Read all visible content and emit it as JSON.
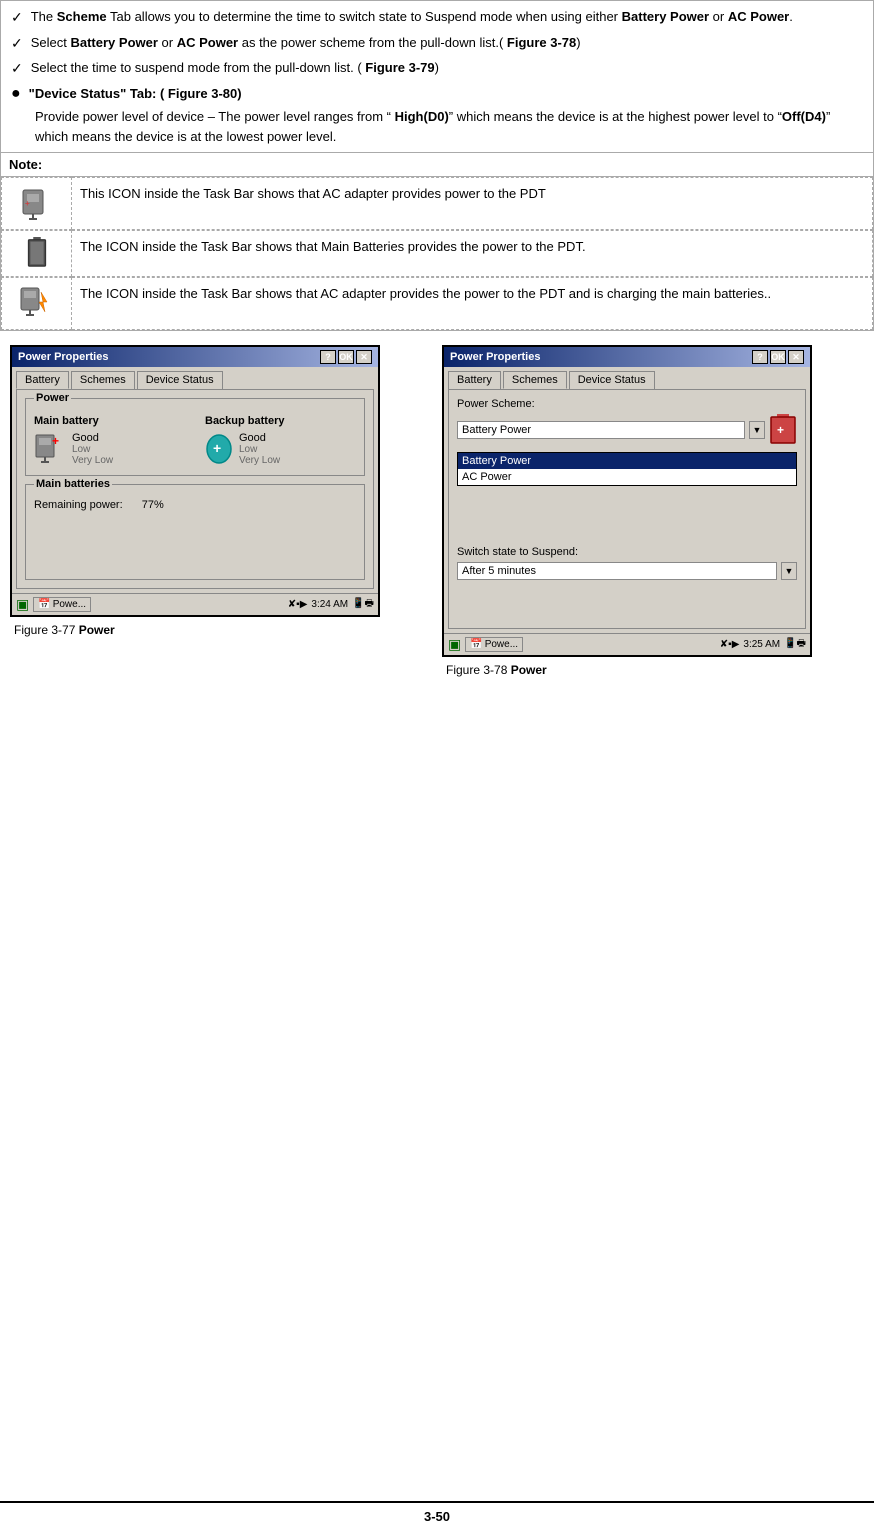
{
  "content": {
    "checklist": [
      {
        "id": "scheme-tab",
        "text_before": "The ",
        "bold1": "Scheme",
        "text_middle1": " Tab allows you to determine the time to switch state to Suspend mode when using either ",
        "bold2": "Battery Power",
        "text_middle2": " or ",
        "bold3": "AC Power",
        "text_end": "."
      },
      {
        "id": "select-power",
        "text_before": "Select ",
        "bold1": "Battery Power",
        "text_middle": " or ",
        "bold2": "AC Power",
        "text_end": " as the power scheme from the pull-down list.( ",
        "bold3": "Figure 3-78",
        "text_end2": ")"
      },
      {
        "id": "select-time",
        "text_before": "Select the time to suspend mode from the pull-down list. ( ",
        "bold1": "Figure 3-79",
        "text_end": ")"
      }
    ],
    "device_status_bullet": {
      "label": "\"Device Status\" Tab: ( Figure 3-80)",
      "description_before": "Provide power level of device – The power level ranges from “ ",
      "bold1": "High(D0)",
      "text_mid": "” which means the device is at the highest power level to “",
      "bold2": "Off(D4)",
      "text_end": "” which means the device is at the lowest power level."
    },
    "note_label": "Note:",
    "icons_table": [
      {
        "id": "ac-icon",
        "description": "This ICON inside the Task Bar shows that AC adapter provides power to the PDT"
      },
      {
        "id": "battery-icon",
        "description": "The ICON inside the Task Bar shows that Main Batteries provides the power to the PDT."
      },
      {
        "id": "charging-icon",
        "description": "The ICON inside the Task Bar shows that AC adapter provides the power to the PDT and is charging the main batteries.."
      }
    ],
    "figures": [
      {
        "id": "fig-77",
        "caption_prefix": "Figure 3-77 ",
        "caption_bold": "Power",
        "dialog": {
          "title": "Power Properties",
          "tabs": [
            "Battery",
            "Schemes",
            "Device Status"
          ],
          "active_tab": "Battery",
          "group_power": {
            "label": "Power",
            "main_battery_label": "Main battery",
            "main_battery_status": "Good",
            "main_battery_low": "Low",
            "main_battery_vlow": "Very Low",
            "backup_battery_label": "Backup battery",
            "backup_battery_status": "Good",
            "backup_battery_low": "Low",
            "backup_battery_vlow": "Very Low"
          },
          "group_main_batteries": {
            "label": "Main batteries",
            "remaining_label": "Remaining power:",
            "remaining_value": "77%"
          },
          "taskbar": {
            "start_icon": "♥",
            "powe_label": "Powe...",
            "time": "3:24 AM"
          }
        }
      },
      {
        "id": "fig-78",
        "caption_prefix": "Figure 3-78 ",
        "caption_bold": "Power",
        "dialog": {
          "title": "Power Properties",
          "tabs": [
            "Battery",
            "Schemes",
            "Device Status"
          ],
          "active_tab": "Schemes",
          "power_scheme_label": "Power Scheme:",
          "dropdown_value": "Battery Power",
          "list_items": [
            "Battery Power",
            "AC Power"
          ],
          "selected_item": "Battery Power",
          "switch_state_label": "Switch state to Suspend:",
          "suspend_value": "After 5 minutes",
          "taskbar": {
            "start_icon": "♥",
            "powe_label": "Powe...",
            "time": "3:25 AM"
          }
        }
      }
    ],
    "page_number": "3-50"
  }
}
